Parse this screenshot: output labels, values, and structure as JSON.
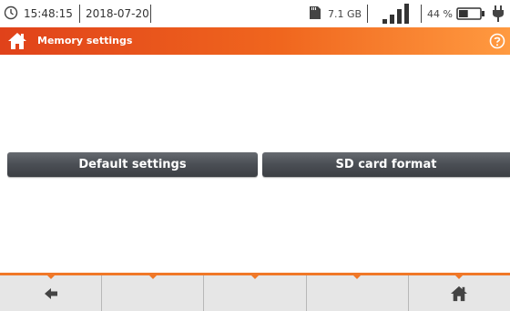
{
  "status_bar": {
    "time": "15:48:15",
    "date": "2018-07-20",
    "sd_size": "7.1 GB",
    "battery_percent": "44 %",
    "battery_level": 0.44,
    "signal_bars": 4,
    "icons": [
      "clock-icon",
      "sd-card-icon",
      "signal-icon",
      "battery-icon",
      "plug-icon"
    ]
  },
  "title_bar": {
    "title": "Memory settings",
    "icons": [
      "home-icon",
      "help-icon"
    ],
    "color_start": "#e0421a",
    "color_end": "#ff9a40"
  },
  "main": {
    "buttons": [
      {
        "label": "Default settings"
      },
      {
        "label": "SD card format"
      }
    ]
  },
  "toolbar": {
    "items": [
      {
        "icon": "back-arrow-icon"
      },
      {
        "icon": ""
      },
      {
        "icon": ""
      },
      {
        "icon": ""
      },
      {
        "icon": "home-icon"
      }
    ],
    "accent": "#f07828"
  }
}
